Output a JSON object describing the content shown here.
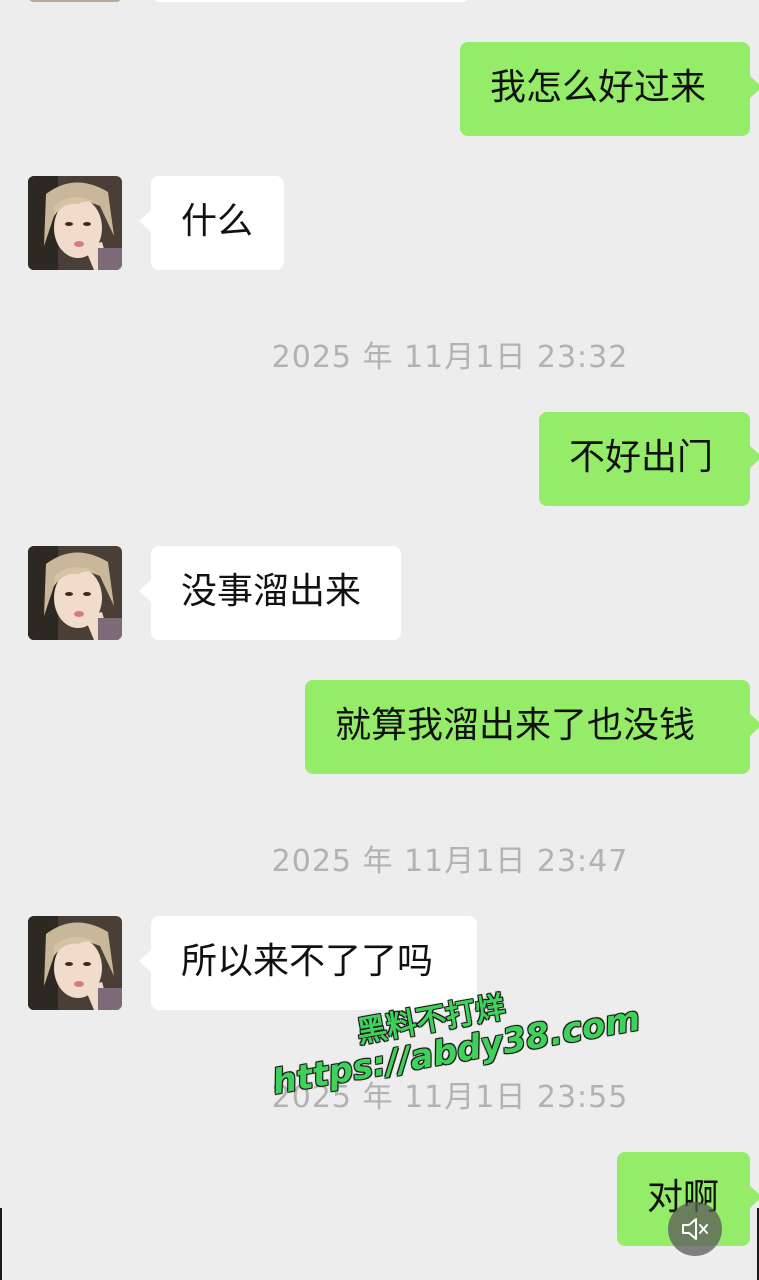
{
  "messages": [
    {
      "side": "out",
      "text": "我怎么好过来"
    },
    {
      "side": "in",
      "text": "什么"
    },
    {
      "side": "in",
      "text": "没事溜出来"
    },
    {
      "side": "out",
      "text": "不好出门"
    },
    {
      "side": "out",
      "text": "就算我溜出来了也没钱"
    },
    {
      "side": "in",
      "text": "所以来不了了吗"
    },
    {
      "side": "out",
      "text": "对啊"
    }
  ],
  "timestamps": [
    "2025 年 11月1日 23:32",
    "2025 年 11月1日 23:47",
    "2025 年 11月1日 23:55"
  ],
  "watermark": {
    "line1": "黑料不打烊",
    "line2": "https://abdy38.com"
  },
  "icons": {
    "mute": "speaker-muted-icon",
    "avatar": "contact-avatar"
  },
  "colors": {
    "background": "#ededed",
    "outgoing_bubble": "#95ec69",
    "incoming_bubble": "#ffffff",
    "timestamp_text": "#b2b2b2",
    "watermark_text": "#3fd25a"
  }
}
